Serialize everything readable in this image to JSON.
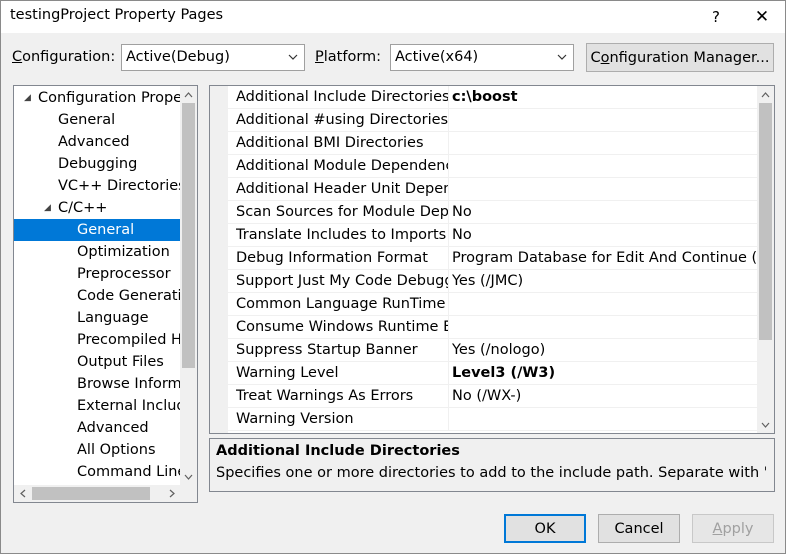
{
  "window": {
    "title": "testingProject Property Pages",
    "help": "?",
    "close": "✕"
  },
  "config": {
    "configuration_label_pre": "",
    "configuration_label_u": "C",
    "configuration_label_post": "onfiguration:",
    "configuration_value": "Active(Debug)",
    "platform_label_u": "P",
    "platform_label_post": "latform:",
    "platform_value": "Active(x64)",
    "manager_button_pre": "C",
    "manager_button_u": "o",
    "manager_button_post": "nfiguration Manager..."
  },
  "tree": {
    "items": [
      {
        "label": "Configuration Propert",
        "expander": "◢",
        "level": 0
      },
      {
        "label": "General",
        "level": 1
      },
      {
        "label": "Advanced",
        "level": 1
      },
      {
        "label": "Debugging",
        "level": 1
      },
      {
        "label": "VC++ Directories",
        "level": 1
      },
      {
        "label": "C/C++",
        "expander": "◢",
        "level": 1
      },
      {
        "label": "General",
        "level": 2,
        "selected": true
      },
      {
        "label": "Optimization",
        "level": 2
      },
      {
        "label": "Preprocessor",
        "level": 2
      },
      {
        "label": "Code Generatio",
        "level": 2
      },
      {
        "label": "Language",
        "level": 2
      },
      {
        "label": "Precompiled He",
        "level": 2
      },
      {
        "label": "Output Files",
        "level": 2
      },
      {
        "label": "Browse Informa",
        "level": 2
      },
      {
        "label": "External Include",
        "level": 2
      },
      {
        "label": "Advanced",
        "level": 2
      },
      {
        "label": "All Options",
        "level": 2
      },
      {
        "label": "Command Line",
        "level": 2
      }
    ]
  },
  "grid": {
    "rows": [
      {
        "name": "Additional Include Directories",
        "value": "c:\\boost",
        "bold": true
      },
      {
        "name": "Additional #using Directories",
        "value": ""
      },
      {
        "name": "Additional BMI Directories",
        "value": ""
      },
      {
        "name": "Additional Module Dependencies",
        "value": ""
      },
      {
        "name": "Additional Header Unit Dependencies",
        "value": ""
      },
      {
        "name": "Scan Sources for Module Dependencies",
        "value": "No"
      },
      {
        "name": "Translate Includes to Imports",
        "value": "No"
      },
      {
        "name": "Debug Information Format",
        "value": "Program Database for Edit And Continue (/ZI)"
      },
      {
        "name": "Support Just My Code Debugging",
        "value": "Yes (/JMC)"
      },
      {
        "name": "Common Language RunTime Support",
        "value": ""
      },
      {
        "name": "Consume Windows Runtime Extension",
        "value": ""
      },
      {
        "name": "Suppress Startup Banner",
        "value": "Yes (/nologo)"
      },
      {
        "name": "Warning Level",
        "value": "Level3 (/W3)",
        "bold": true
      },
      {
        "name": "Treat Warnings As Errors",
        "value": "No (/WX-)"
      },
      {
        "name": "Warning Version",
        "value": ""
      }
    ]
  },
  "description": {
    "title": "Additional Include Directories",
    "text": "Specifies one or more directories to add to the include path. Separate with ';' if m..."
  },
  "buttons": {
    "ok": "OK",
    "cancel": "Cancel",
    "apply_u": "A",
    "apply_post": "pply"
  },
  "colors": {
    "selection": "#0078d7",
    "window_bg": "#f0f0f0",
    "border": "#828790"
  }
}
